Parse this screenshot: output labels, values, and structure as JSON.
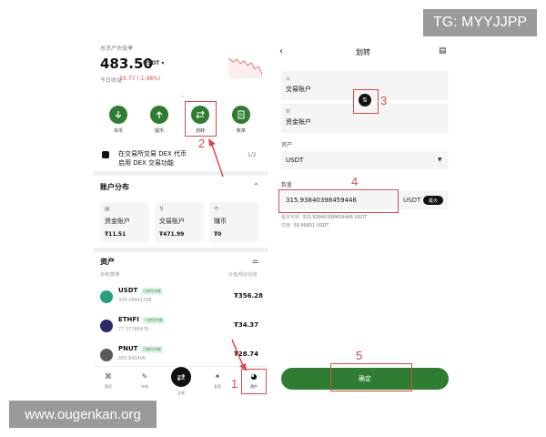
{
  "watermarks": {
    "tg": "TG: MYYJJPP",
    "site": "www.ougenkan.org"
  },
  "left": {
    "header": {
      "estimate_label": "总资产估值",
      "balance": "483.50",
      "balance_unit": "USDT",
      "pnl_label": "今日收益",
      "pnl_value": "-19.77 (-1.98%)"
    },
    "actions": [
      {
        "label": "充币",
        "icon": "download-icon"
      },
      {
        "label": "提币",
        "icon": "upload-icon"
      },
      {
        "label": "划转",
        "icon": "transfer-icon"
      },
      {
        "label": "账单",
        "icon": "bill-icon"
      }
    ],
    "dex_banner": {
      "line1": "在交易所交易 DEX 代币",
      "line2": "启用 DEX 交易功能",
      "page": "1/2"
    },
    "account_section": {
      "title": "账户分布",
      "cards": [
        {
          "name": "资金账户",
          "value": "₮11.51"
        },
        {
          "name": "交易账户",
          "value": "₮471.99"
        },
        {
          "name": "赚币",
          "value": "₮0"
        }
      ]
    },
    "assets_section": {
      "title": "资产",
      "col_left": "名称/数量",
      "col_right": "价值/现价估值",
      "rows": [
        {
          "symbol": "USDT",
          "tag": "可使用余额",
          "qty": "356.28441398",
          "amount": "₮356.28",
          "color": "#26a17b"
        },
        {
          "symbol": "ETHFI",
          "tag": "可使用余额",
          "qty": "77.57786476",
          "amount": "₮34.37",
          "color": "#2b2c6b"
        },
        {
          "symbol": "PNUT",
          "tag": "可使用余额",
          "qty": "665.843496",
          "amount": "₮28.74",
          "color": "#5a5a5a"
        }
      ]
    },
    "bottom_nav": [
      {
        "label": "首页",
        "icon": "home-icon"
      },
      {
        "label": "市场",
        "icon": "market-icon"
      },
      {
        "label": "交易",
        "icon": "trade-icon"
      },
      {
        "label": "发现",
        "icon": "discover-icon"
      },
      {
        "label": "资产",
        "icon": "assets-icon"
      }
    ]
  },
  "right": {
    "title": "划转",
    "from_label": "从",
    "from_value": "交易账户",
    "to_label": "到",
    "to_value": "资金账户",
    "asset_label": "资产",
    "asset_value": "USDT",
    "qty_label": "数量",
    "qty_value": "315.93840398459446",
    "qty_unit": "USDT",
    "max_label": "最大",
    "info1_label": "最多可转",
    "info1_value": "315.93840398459446 USDT",
    "info2_label": "估值",
    "info2_value": "39.96801 USDT",
    "confirm_label": "确定"
  },
  "annotations": {
    "n1": "1",
    "n2": "2",
    "n3": "3",
    "n4": "4",
    "n5": "5"
  },
  "colors": {
    "accent_green": "#2f7d32",
    "annotation_red": "#d94848",
    "pnl_red": "#e04a4a"
  }
}
